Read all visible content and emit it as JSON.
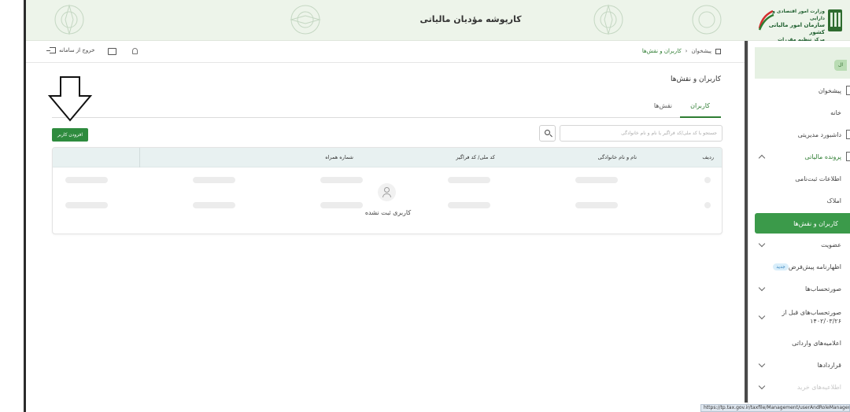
{
  "header": {
    "title": "کارپوشه مؤدیان مالیاتی",
    "logo_lines": [
      "وزارت امور اقتصادی و دارایی",
      "سازمان امور مالیاتی کشور",
      "مرکز تنظیم مقررات"
    ]
  },
  "topbar": {
    "logout_label": "خروج از سامانه",
    "breadcrumb": [
      "پیشخوان",
      "کاربران و نقش‌ها"
    ]
  },
  "sidebar": {
    "pill_label": "ال",
    "items": [
      {
        "label": "پیشخوان"
      },
      {
        "label": "خانه"
      },
      {
        "label": "داشبورد مدیریتی"
      },
      {
        "label": "پرونده مالیاتی"
      },
      {
        "label": "اطلاعات ثبت‌نامی"
      },
      {
        "label": "املاک"
      },
      {
        "label": "کاربران و نقش‌ها"
      },
      {
        "label": "عضویت"
      },
      {
        "label": "اظهارنامه پیش‌فرض",
        "badge": "جدید"
      },
      {
        "label": "صورتحساب‌ها"
      },
      {
        "label": "صورتحساب‌های قبل از ۱۴۰۲/۰۳/۲۶"
      },
      {
        "label": "اعلامیه‌های وارداتی"
      },
      {
        "label": "قراردادها"
      },
      {
        "label": "اطلاعیه‌های خرید"
      }
    ]
  },
  "main": {
    "page_title": "کاربران و نقش‌ها",
    "tabs": [
      {
        "label": "کاربران",
        "active": true
      },
      {
        "label": "نقش‌ها",
        "active": false
      }
    ],
    "search_placeholder": "جستجو با کد ملی/کد فراگیر یا نام و نام خانوادگی",
    "add_button": "افزودن کاربر",
    "table": {
      "columns": [
        "ردیف",
        "نام و نام خانوادگی",
        "کد ملی/ کد فراگیر",
        "شماره همراه"
      ],
      "empty_text": "کاربری ثبت نشده"
    }
  },
  "status_url": "https://tp.tax.gov.ir/taxfile/Management/userAndRoleManagement",
  "colors": {
    "primary_green": "#2e8b3e",
    "header_bg": "#edf4ea",
    "table_header_bg": "#e8f1f1"
  }
}
